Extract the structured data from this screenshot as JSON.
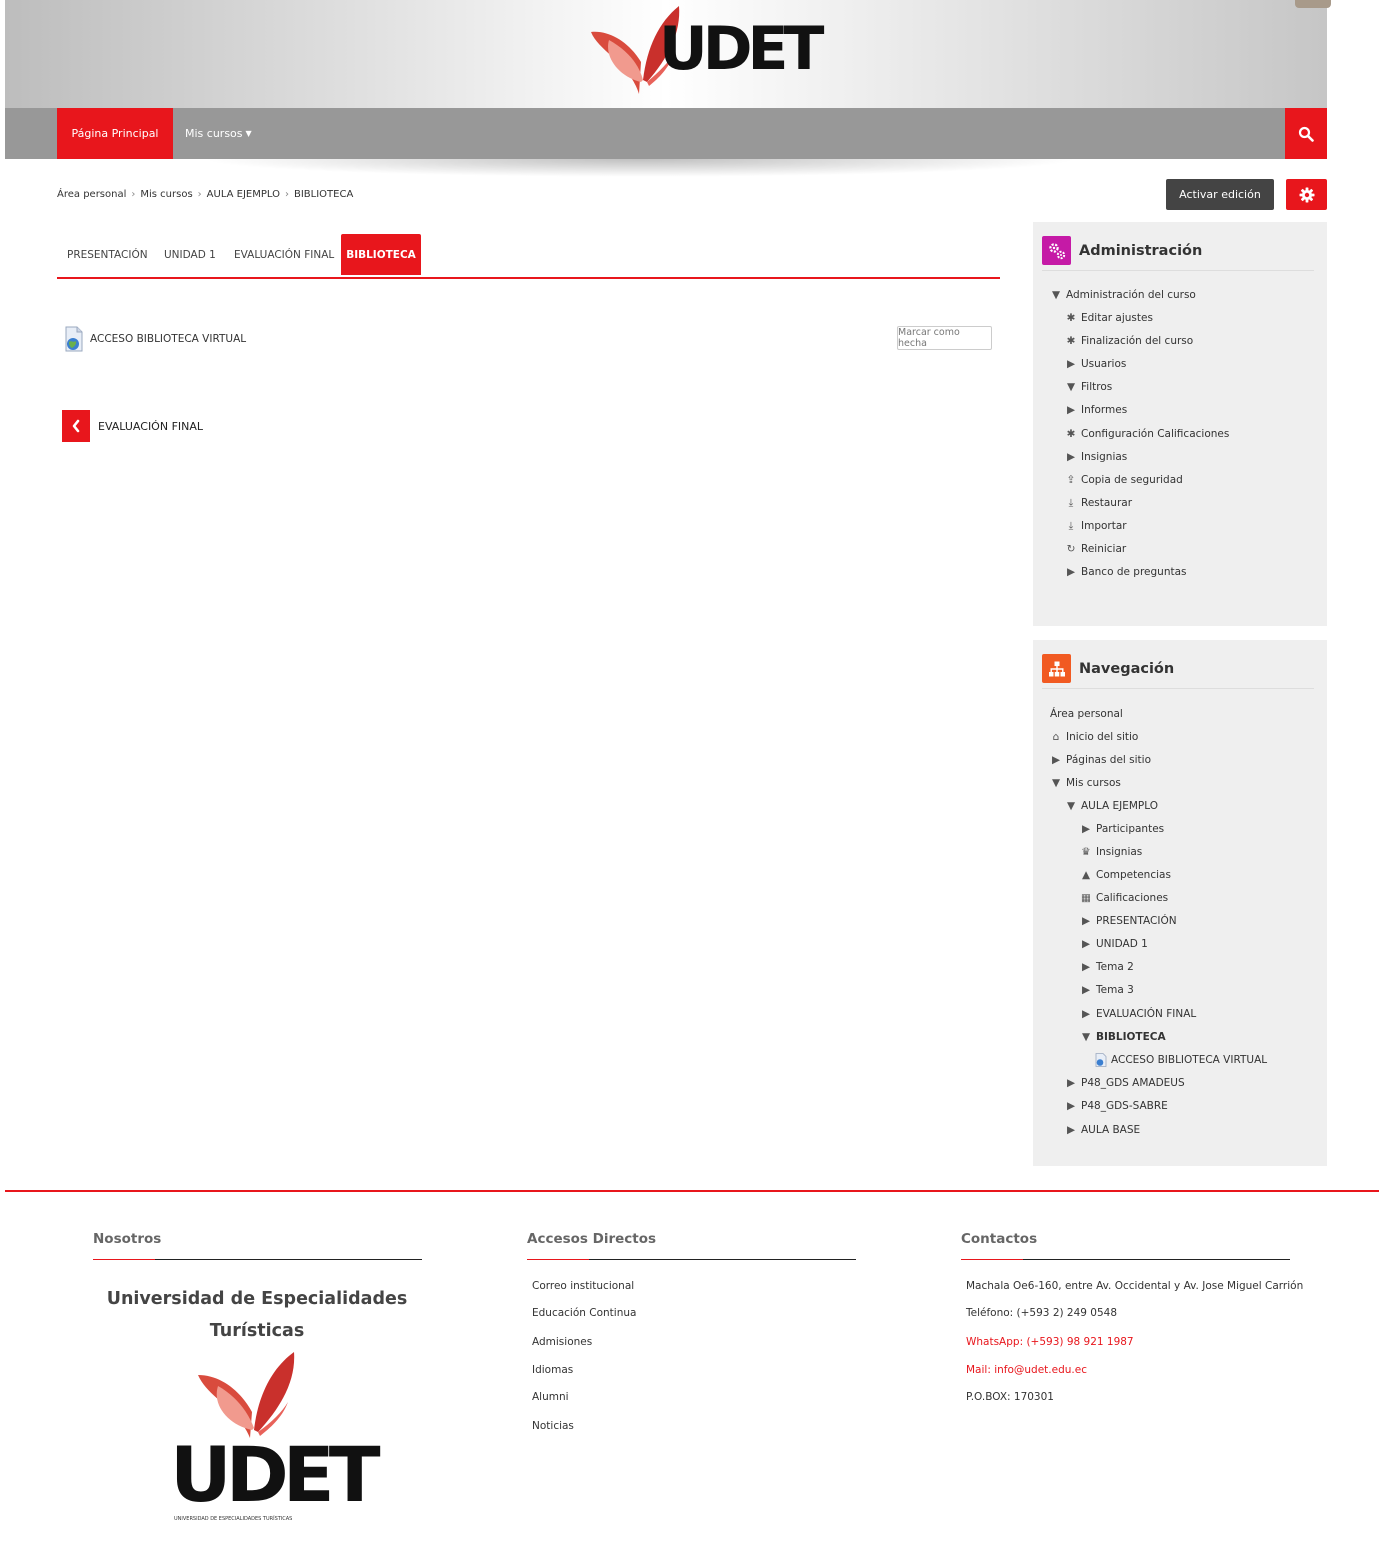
{
  "header": {
    "logo_text": "UDET"
  },
  "navbar": {
    "home": "Página Principal",
    "courses": "Mis cursos",
    "caret": "▼"
  },
  "breadcrumb": [
    "Área personal",
    "Mis cursos",
    "AULA EJEMPLO",
    "BIBLIOTECA"
  ],
  "breadcrumb_sep": "›",
  "actions": {
    "edit": "Activar edición"
  },
  "tabs": [
    "PRESENTACIÓN",
    "UNIDAD 1",
    "EVALUACIÓN FINAL",
    "BIBLIOTECA"
  ],
  "content": {
    "activity": "ACCESO BIBLIOTECA VIRTUAL",
    "mark_done": "Marcar como hecha",
    "prev_section": "EVALUACIÓN FINAL"
  },
  "admin": {
    "title": "Administración",
    "items": [
      {
        "label": "Administración del curso",
        "icon": "triangle-down-icon"
      },
      {
        "label": "Editar ajustes",
        "icon": "gear-icon"
      },
      {
        "label": "Finalización del curso",
        "icon": "gear-icon"
      },
      {
        "label": "Usuarios",
        "icon": "triangle-right-icon"
      },
      {
        "label": "Filtros",
        "icon": "filter-icon"
      },
      {
        "label": "Informes",
        "icon": "triangle-right-icon"
      },
      {
        "label": "Configuración Calificaciones",
        "icon": "gear-icon"
      },
      {
        "label": "Insignias",
        "icon": "triangle-right-icon"
      },
      {
        "label": "Copia de seguridad",
        "icon": "upload-icon"
      },
      {
        "label": "Restaurar",
        "icon": "download-icon"
      },
      {
        "label": "Importar",
        "icon": "download-icon"
      },
      {
        "label": "Reiniciar",
        "icon": "refresh-icon"
      },
      {
        "label": "Banco de preguntas",
        "icon": "triangle-right-icon"
      }
    ]
  },
  "navigation": {
    "title": "Navegación",
    "items": [
      {
        "label": "Área personal",
        "icon": ""
      },
      {
        "label": "Inicio del sitio",
        "icon": "home-icon"
      },
      {
        "label": "Páginas del sitio",
        "icon": "triangle-right-icon"
      },
      {
        "label": "Mis cursos",
        "icon": "triangle-down-icon"
      },
      {
        "label": "AULA EJEMPLO",
        "icon": "triangle-down-icon"
      },
      {
        "label": "Participantes",
        "icon": "triangle-right-icon"
      },
      {
        "label": "Insignias",
        "icon": "trophy-icon"
      },
      {
        "label": "Competencias",
        "icon": "competency-icon"
      },
      {
        "label": "Calificaciones",
        "icon": "table-icon"
      },
      {
        "label": "PRESENTACIÓN",
        "icon": "triangle-right-icon"
      },
      {
        "label": "UNIDAD 1",
        "icon": "triangle-right-icon"
      },
      {
        "label": "Tema 2",
        "icon": "triangle-right-icon"
      },
      {
        "label": "Tema 3",
        "icon": "triangle-right-icon"
      },
      {
        "label": "EVALUACIÓN FINAL",
        "icon": "triangle-right-icon"
      },
      {
        "label": "BIBLIOTECA",
        "icon": "triangle-down-icon"
      },
      {
        "label": "ACCESO BIBLIOTECA VIRTUAL",
        "icon": "url-resource-icon"
      },
      {
        "label": "P48_GDS AMADEUS",
        "icon": "triangle-right-icon"
      },
      {
        "label": "P48_GDS-SABRE",
        "icon": "triangle-right-icon"
      },
      {
        "label": "AULA BASE",
        "icon": "triangle-right-icon"
      }
    ]
  },
  "footer": {
    "nosotros": {
      "title": "Nosotros",
      "name": "Universidad de Especialidades Turísticas",
      "logo_text": "UDET",
      "logo_sub": "UNIVERSIDAD DE ESPECIALIDADES TURÍSTICAS"
    },
    "accesos": {
      "title": "Accesos Directos",
      "links": [
        "Correo institucional",
        "Educación Continua",
        "Admisiones",
        "Idiomas",
        "Alumni",
        "Noticias"
      ]
    },
    "contactos": {
      "title": "Contactos",
      "address": "Machala Oe6-160, entre Av. Occidental y Av. Jose Miguel Carrión",
      "phone": "Teléfono: (+593 2) 249 0548",
      "whatsapp": "WhatsApp: (+593) 98 921 1987",
      "mail": "Mail: info@udet.edu.ec",
      "pobox": "P.O.BOX: 170301"
    }
  },
  "colors": {
    "accent": "#e8161c",
    "nav": "#989898",
    "dark_button": "#444444",
    "admin_icon": "#c51aa6",
    "nav_icon": "#f15a22"
  }
}
